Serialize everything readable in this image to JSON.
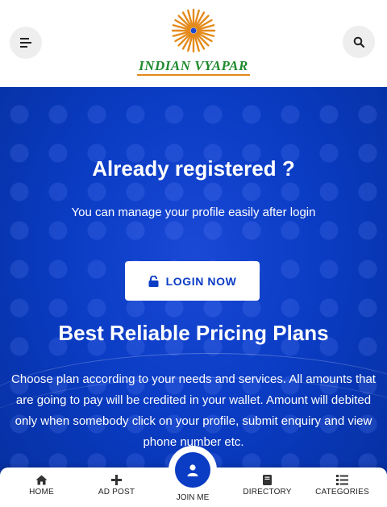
{
  "header": {
    "logo_text": "INDIAN VYAPAR"
  },
  "hero": {
    "title": "Already registered ?",
    "subtitle": "You can manage your profile easily after login",
    "login_label": "LOGIN NOW",
    "plans_title": "Best Reliable Pricing Plans",
    "plans_text": "Choose plan according to your needs and services. All amounts that are going to pay will be credited in your wallet. Amount will debited only when somebody click on your profile, submit enquiry and view phone number etc."
  },
  "nav": {
    "home": "HOME",
    "ad_post": "AD POST",
    "join_me": "JOIN ME",
    "directory": "DIRECTORY",
    "categories": "CATEGORIES"
  },
  "colors": {
    "brand_blue": "#0a3cc4",
    "logo_green": "#1f8a2e",
    "logo_orange": "#e48a1a"
  },
  "icons": [
    "menu-icon",
    "search-icon",
    "logo-chakra-icon",
    "lock-icon",
    "home-icon",
    "plus-icon",
    "user-icon",
    "book-icon",
    "list-icon"
  ]
}
